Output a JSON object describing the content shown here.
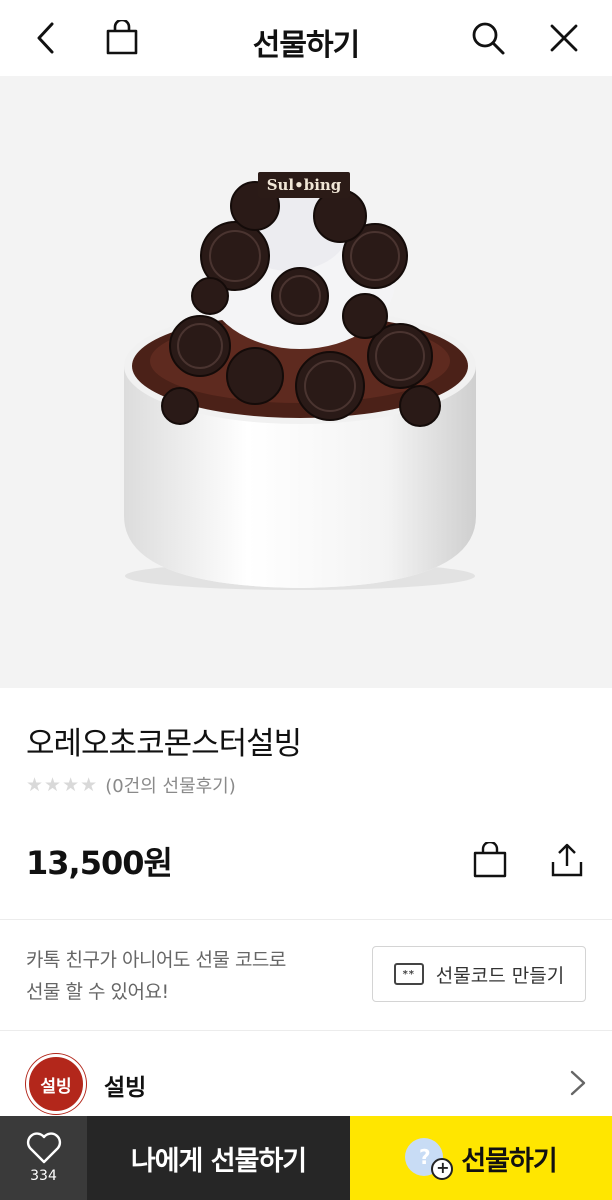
{
  "header": {
    "title": "선물하기",
    "icons": [
      "back-icon",
      "shopping-bag-icon",
      "search-icon",
      "close-icon"
    ]
  },
  "product": {
    "image_alt_icon": "oreo-bingsu-image",
    "image_lid_text": "Sul•bing",
    "name": "오레오초코몬스터설빙",
    "rating_stars": 0,
    "review_text": "(0건의 선물후기)",
    "price": "13,500원"
  },
  "gift_code": {
    "description_line1": "카톡 친구가 아니어도 선물 코드로",
    "description_line2": "선물 할 수 있어요!",
    "button_label": "선물코드 만들기",
    "icon_text": "**"
  },
  "brand": {
    "name": "설빙",
    "logo_text": "설빙"
  },
  "bottom_bar": {
    "like_count": "334",
    "gift_to_me_label": "나에게 선물하기",
    "gift_label": "선물하기",
    "friend_icon_text": "?",
    "friend_plus_text": "+"
  },
  "colors": {
    "gift_button_bg": "#ffe600",
    "gift_me_bg": "#262626",
    "like_bg": "#3a3a3a",
    "brand_red": "#b3271b"
  }
}
